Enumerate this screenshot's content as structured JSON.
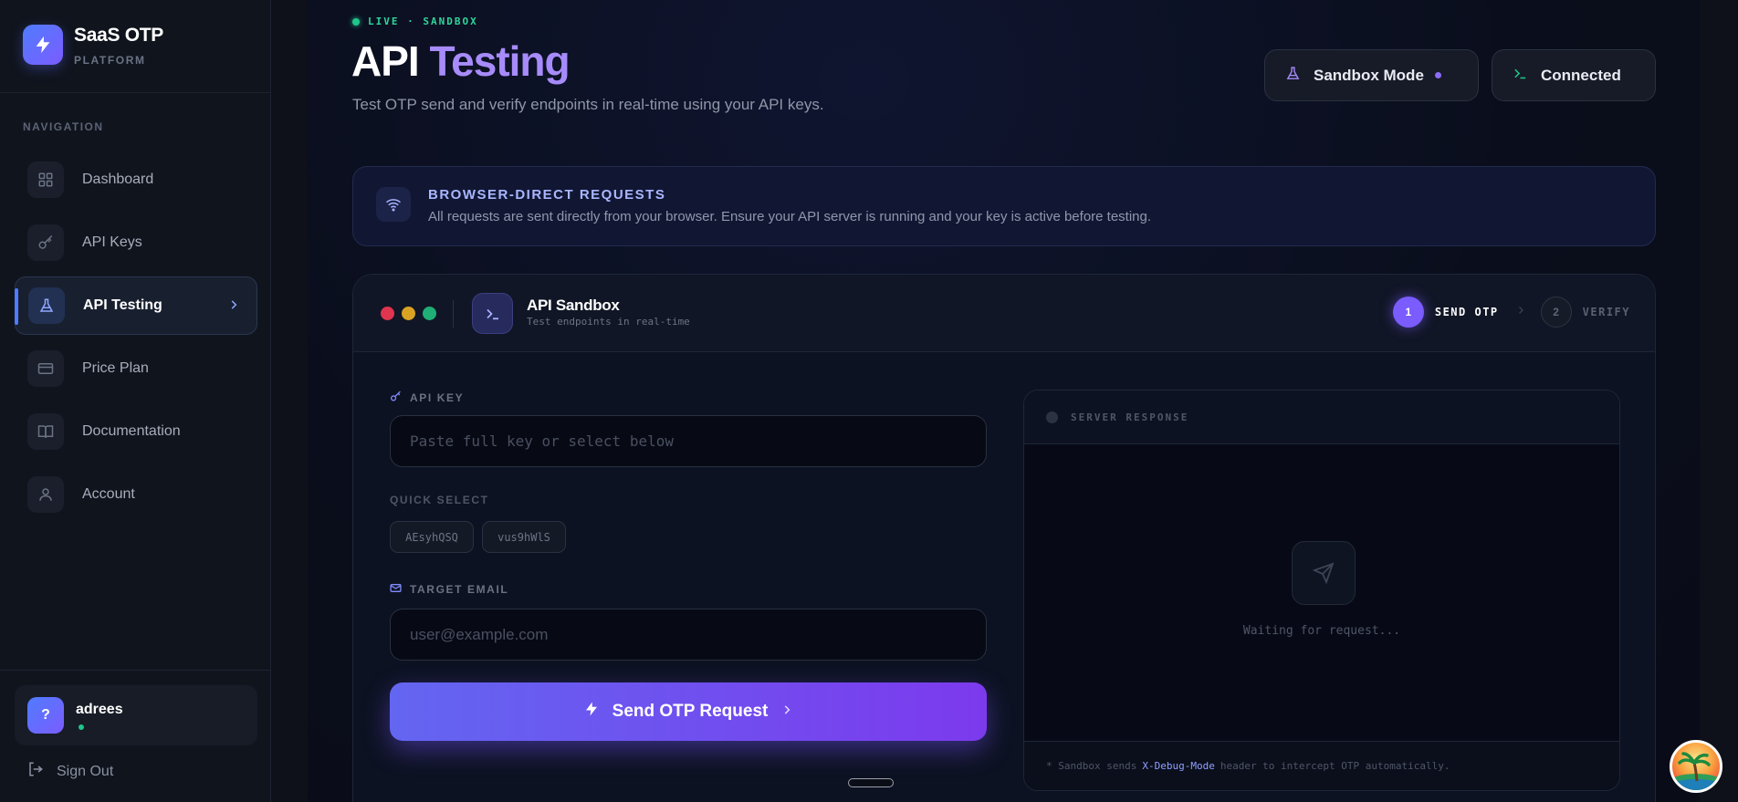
{
  "app": {
    "name": "SaaS OTP",
    "subtitle": "PLATFORM"
  },
  "sidebar": {
    "heading": "NAVIGATION",
    "items": [
      {
        "label": "Dashboard",
        "icon": "grid-icon",
        "active": false
      },
      {
        "label": "API Keys",
        "icon": "key-icon",
        "active": false
      },
      {
        "label": "API Testing",
        "icon": "flask-icon",
        "active": true
      },
      {
        "label": "Price Plan",
        "icon": "credit-card-icon",
        "active": false
      },
      {
        "label": "Documentation",
        "icon": "book-icon",
        "active": false
      },
      {
        "label": "Account",
        "icon": "user-icon",
        "active": false
      }
    ],
    "user": {
      "avatar_text": "?",
      "name": "adrees",
      "status": "online"
    },
    "sign_out": "Sign Out"
  },
  "header": {
    "live_tag": "LIVE · SANDBOX",
    "title_main": "API",
    "title_accent": "Testing",
    "subtitle": "Test OTP send and verify endpoints in real-time using your API keys.",
    "sandbox_pill": "Sandbox Mode",
    "connected_pill": "Connected"
  },
  "banner": {
    "title": "BROWSER-DIRECT REQUESTS",
    "text": "All requests are sent directly from your browser. Ensure your API server is running and your key is active before testing."
  },
  "sandbox": {
    "title": "API Sandbox",
    "subtitle": "Test endpoints in real-time",
    "steps": [
      {
        "num": "1",
        "label": "SEND OTP",
        "active": true
      },
      {
        "num": "2",
        "label": "VERIFY",
        "active": false
      }
    ],
    "api_key_label": "API KEY",
    "api_key_placeholder": "Paste full key or select below",
    "api_key_value": "",
    "quick_select_label": "QUICK SELECT",
    "quick_keys": [
      "AEsyhQSQ",
      "vus9hWlS"
    ],
    "email_label": "TARGET EMAIL",
    "email_placeholder": "user@example.com",
    "email_value": "",
    "send_button": "Send OTP Request",
    "response_title": "SERVER RESPONSE",
    "response_empty": "Waiting for request...",
    "footer_prefix": "* Sandbox sends",
    "footer_header": "X-Debug-Mode",
    "footer_suffix": "header to intercept OTP automatically."
  },
  "colors": {
    "accent": "#7b5cff",
    "accent_blue": "#4f7cff",
    "success": "#22c58b",
    "title_accent": "#a78bfa"
  }
}
